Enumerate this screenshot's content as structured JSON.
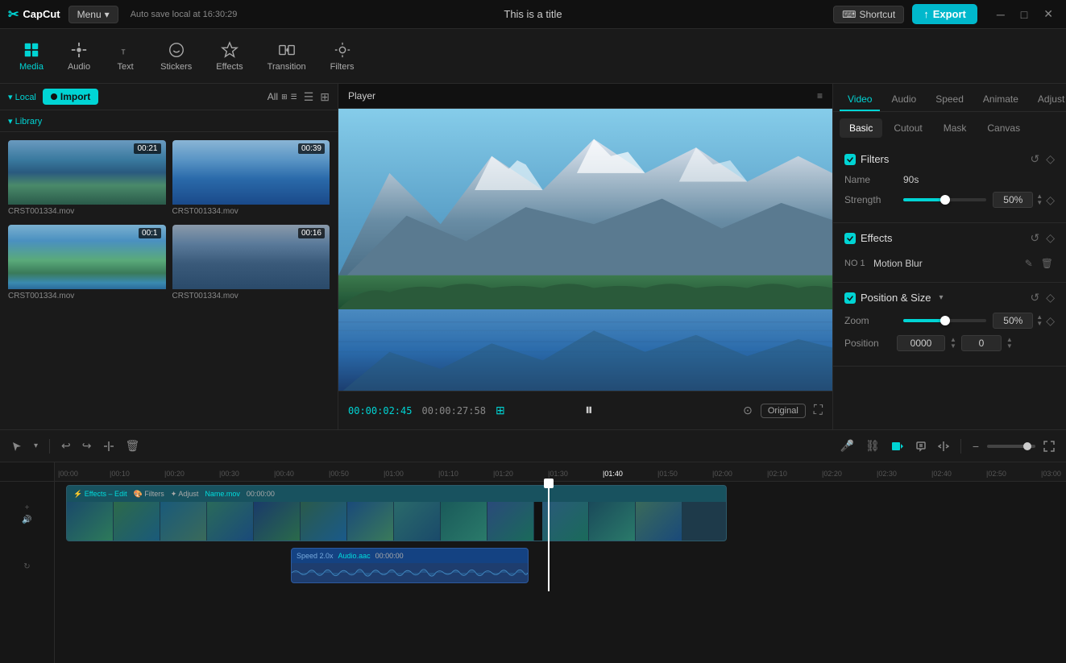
{
  "app": {
    "name": "CapCut",
    "title": "This is a title",
    "autosave": "Auto save local at 16:30:29"
  },
  "topbar": {
    "menu_label": "Menu",
    "shortcut_label": "Shortcut",
    "export_label": "Export"
  },
  "toolbar": {
    "items": [
      {
        "id": "media",
        "label": "Media",
        "active": true
      },
      {
        "id": "audio",
        "label": "Audio"
      },
      {
        "id": "text",
        "label": "Text"
      },
      {
        "id": "stickers",
        "label": "Stickers"
      },
      {
        "id": "effects",
        "label": "Effects"
      },
      {
        "id": "transition",
        "label": "Transition"
      },
      {
        "id": "filters",
        "label": "Filters"
      }
    ]
  },
  "left_panel": {
    "local_label": "Local",
    "library_label": "Library",
    "import_label": "Import",
    "all_label": "All",
    "media_items": [
      {
        "name": "CRST001334.mov",
        "duration": "00:21",
        "thumb_class": "thumb-mountain1"
      },
      {
        "name": "CRST001334.mov",
        "duration": "00:39",
        "thumb_class": "thumb-water1"
      },
      {
        "name": "CRST001334.mov",
        "duration": "00:1",
        "thumb_class": "thumb-lake1"
      },
      {
        "name": "CRST001334.mov",
        "duration": "00:16",
        "thumb_class": "thumb-cloud1"
      }
    ]
  },
  "player": {
    "title": "Player",
    "time_current": "00:00:02:45",
    "time_total": "00:00:27:58",
    "original_label": "Original"
  },
  "right_panel": {
    "tabs": [
      "Video",
      "Audio",
      "Speed",
      "Animate",
      "Adjust"
    ],
    "active_tab": "Video",
    "basic_tabs": [
      "Basic",
      "Cutout",
      "Mask",
      "Canvas"
    ],
    "active_basic_tab": "Basic",
    "filters_section": {
      "title": "Filters",
      "name_label": "Name",
      "name_value": "90s",
      "strength_label": "Strength",
      "strength_value": "50%",
      "strength_pct": 50
    },
    "effects_section": {
      "title": "Effects",
      "items": [
        {
          "num": "NO 1",
          "name": "Motion Blur"
        }
      ]
    },
    "position_section": {
      "title": "Position & Size",
      "zoom_label": "Zoom",
      "zoom_value": "50%",
      "zoom_pct": 50,
      "position_label": "Position",
      "position_x": "0000",
      "position_y": "0"
    }
  },
  "timeline": {
    "track_label": "Effects – Edit",
    "track_filters": "Filters",
    "track_adjust": "Adjust",
    "track_name": "Name.mov",
    "track_time": "00:00:00",
    "audio_label": "Speed 2.0x",
    "audio_name": "Audio.aac",
    "audio_time": "00:00:00",
    "playhead_time": "00:01:38"
  }
}
